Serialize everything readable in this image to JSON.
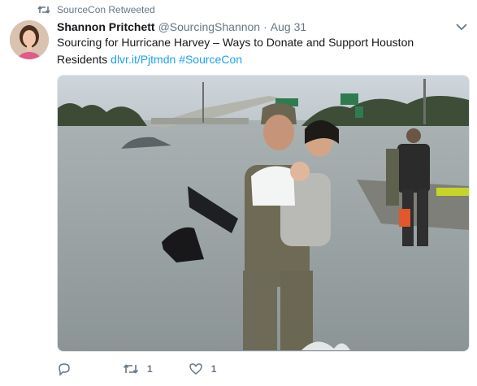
{
  "retweet_banner": {
    "icon": "retweet-icon",
    "text": "SourceCon Retweeted"
  },
  "author": {
    "display_name": "Shannon Pritchett",
    "handle": "@SourcingShannon",
    "separator": "·",
    "date": "Aug 31"
  },
  "tweet": {
    "text": "Sourcing for Hurricane Harvey – Ways to Donate and Support Houston Residents",
    "link": "dlvr.it/Pjtmdn",
    "hashtag": "#SourceCon"
  },
  "actions": {
    "reply": {
      "icon": "reply-icon",
      "count": ""
    },
    "retweet": {
      "icon": "retweet-icon",
      "count": "1"
    },
    "like": {
      "icon": "heart-icon",
      "count": "1"
    }
  },
  "colors": {
    "link": "#1da1f2",
    "muted": "#657786",
    "text": "#14171a"
  }
}
